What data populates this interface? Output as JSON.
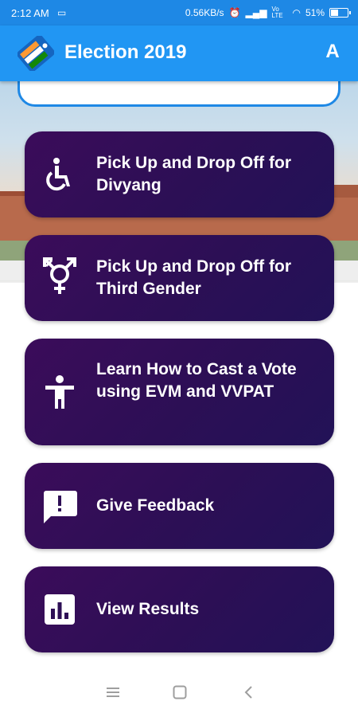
{
  "status_bar": {
    "time": "2:12 AM",
    "speed": "0.56KB/s",
    "volte": "Vo LTE",
    "battery": "51%",
    "battery_level": 0.51
  },
  "app_bar": {
    "title": "Election 2019",
    "avatar_letter": "A"
  },
  "menu": [
    {
      "label": "Pick Up and Drop Off for Divyang",
      "icon": "wheelchair-icon"
    },
    {
      "label": "Pick Up and Drop Off for Third Gender",
      "icon": "transgender-icon"
    },
    {
      "label": "Learn How to Cast a Vote using EVM and VVPAT",
      "icon": "person-icon"
    },
    {
      "label": "Give Feedback",
      "icon": "feedback-icon"
    },
    {
      "label": "View Results",
      "icon": "bar-chart-icon"
    }
  ],
  "colors": {
    "primary": "#2196f3",
    "status_bar": "#1e88e5",
    "card_start": "#3b0c5a",
    "card_end": "#221257"
  },
  "nav": [
    "menu-icon",
    "home-icon",
    "back-icon"
  ]
}
